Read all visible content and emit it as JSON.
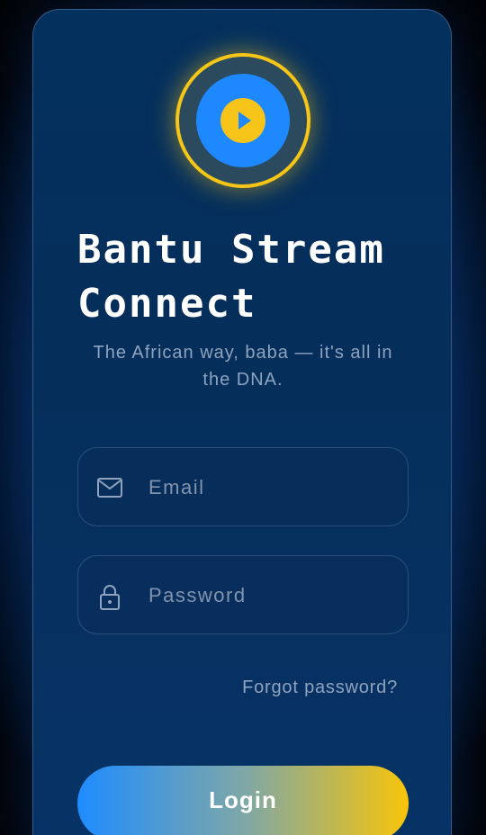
{
  "app": {
    "title": "Bantu Stream Connect",
    "tagline": "The African way, baba — it's all in the DNA."
  },
  "logo": {
    "icon": "play-icon",
    "ring_color": "#f5c518",
    "disc_color": "#1e88ff"
  },
  "form": {
    "email": {
      "placeholder": "Email",
      "value": "",
      "icon": "mail-icon"
    },
    "password": {
      "placeholder": "Password",
      "value": "",
      "icon": "lock-icon"
    },
    "forgot_label": "Forgot password?",
    "login_label": "Login"
  },
  "colors": {
    "accent_blue": "#1e88ff",
    "accent_gold": "#f7c50a",
    "background": "#04305e"
  }
}
